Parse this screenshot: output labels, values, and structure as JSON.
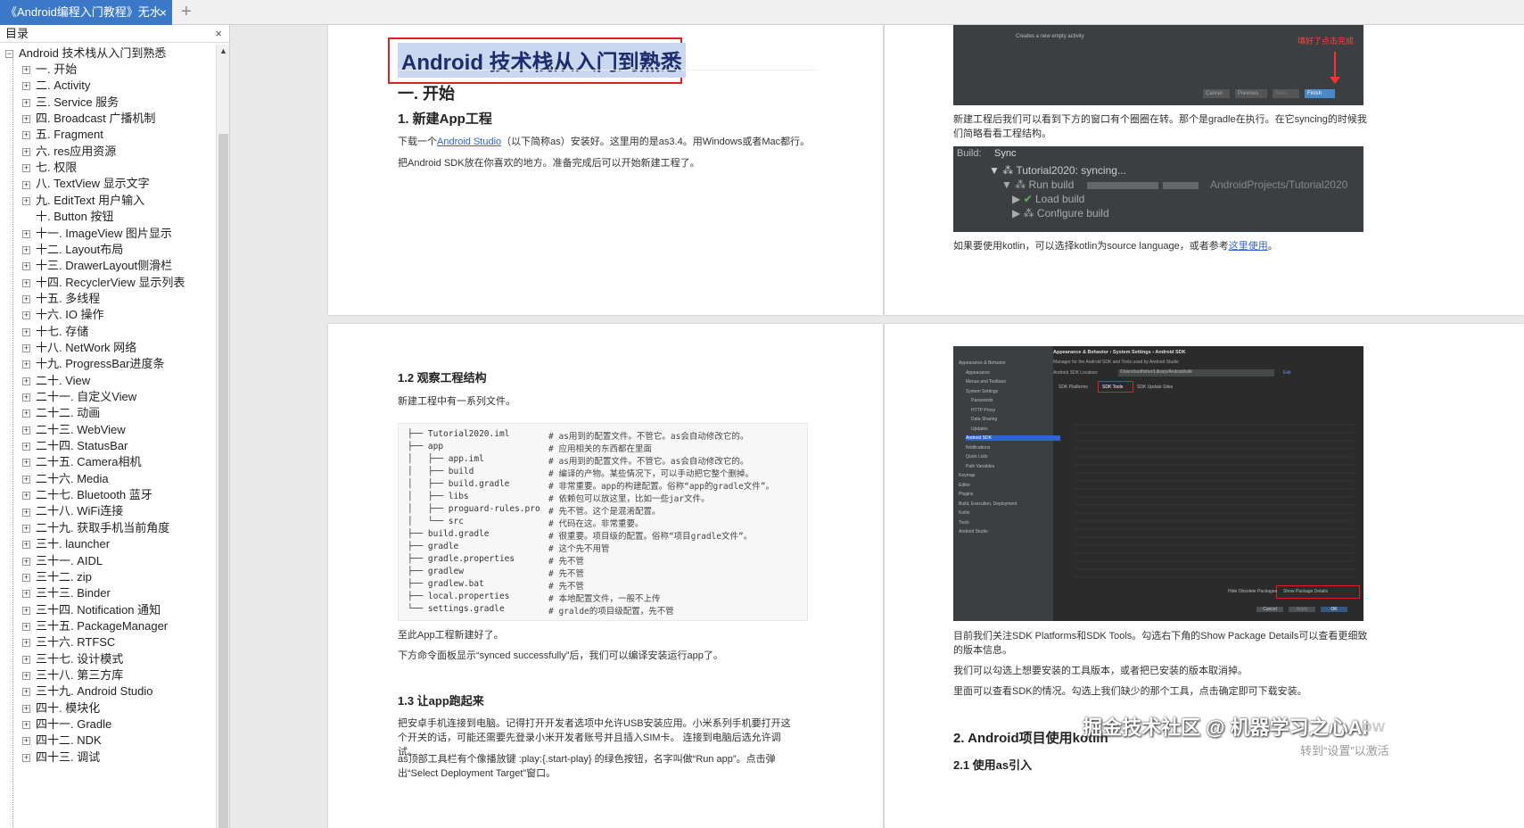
{
  "tab": {
    "title": "《Android编程入门教程》无水",
    "close": "×",
    "new": "+"
  },
  "sidebar": {
    "title": "目录",
    "close": "×",
    "root": "Android 技术栈从入门到熟悉",
    "items": [
      "一. 开始",
      "二. Activity",
      "三. Service 服务",
      "四. Broadcast 广播机制",
      "五. Fragment",
      "六. res应用资源",
      "七. 权限",
      "八. TextView 显示文字",
      "九. EditText 用户输入",
      "十. Button 按钮",
      "十一. ImageView 图片显示",
      "十二. Layout布局",
      "十三. DrawerLayout侧滑栏",
      "十四. RecyclerView 显示列表",
      "十五. 多线程",
      "十六. IO 操作",
      "十七. 存储",
      "十八. NetWork 网络",
      "十九. ProgressBar进度条",
      "二十. View",
      "二十一. 自定义View",
      "二十二. 动画",
      "二十三. WebView",
      "二十四. StatusBar",
      "二十五. Camera相机",
      "二十六. Media",
      "二十七. Bluetooth 蓝牙",
      "二十八. WiFi连接",
      "二十九. 获取手机当前角度",
      "三十. launcher",
      "三十一. AIDL",
      "三十二. zip",
      "三十三. Binder",
      "三十四. Notification 通知",
      "三十五. PackageManager",
      "三十六. RTFSC",
      "三十七. 设计模式",
      "三十八. 第三方库",
      "三十九. Android Studio",
      "四十. 模块化",
      "四十一. Gradle",
      "四十二. NDK",
      "四十三. 调试"
    ]
  },
  "page1": {
    "title": "Android 技术栈从入门到熟悉",
    "h2": "一. 开始",
    "h3": "1. 新建App工程",
    "p1_pre": "下载一个",
    "p1_link": "Android Studio",
    "p1_post": "（以下简称as）安装好。这里用的是as3.4。用Windows或者Mac都行。",
    "p2": "把Android SDK放在你喜欢的地方。准备完成后可以开始新建工程了。"
  },
  "page2": {
    "wizard_caption": "Creates a new empty activity",
    "wizard_note": "填好了点击完成",
    "wizard_buttons": [
      "Cancel",
      "Previous",
      "Next",
      "Finish"
    ],
    "p1": "新建工程后我们可以看到下方的窗口有个圈圈在转。那个是gradle在执行。在它syncing的时候我们简略看看工程结构。",
    "build_label": "Build:",
    "build_tab": "Sync",
    "build_lines": [
      "Tutorial2020: syncing...",
      "Run build",
      "Load build",
      "Configure build"
    ],
    "build_path": "AndroidProjects/Tutorial2020",
    "p2_pre": "如果要使用kotlin，可以选择kotlin为source language，或者参考",
    "p2_link": "这里使用",
    "p2_post": "。"
  },
  "page3": {
    "h3a": "1.2 观察工程结构",
    "p1": "新建工程中有一系列文件。",
    "code": [
      {
        "f": "├── Tutorial2020.iml",
        "c": "# as用到的配置文件。不管它。as会自动修改它的。"
      },
      {
        "f": "├── app",
        "c": "# 应用相关的东西都在里面"
      },
      {
        "f": "│   ├── app.iml",
        "c": "# as用到的配置文件。不管它。as会自动修改它的。"
      },
      {
        "f": "│   ├── build",
        "c": "# 编译的产物。某些情况下，可以手动把它整个删掉。"
      },
      {
        "f": "│   ├── build.gradle",
        "c": "# 非常重要。app的构建配置。俗称“app的gradle文件”。"
      },
      {
        "f": "│   ├── libs",
        "c": "# 依赖包可以放这里，比如一些jar文件。"
      },
      {
        "f": "│   ├── proguard-rules.pro",
        "c": "# 先不管。这个是混淆配置。"
      },
      {
        "f": "│   └── src",
        "c": "# 代码在这。非常重要。"
      },
      {
        "f": "├── build.gradle",
        "c": "# 很重要。项目级的配置。俗称“项目gradle文件”。"
      },
      {
        "f": "├── gradle",
        "c": "# 这个先不用管"
      },
      {
        "f": "├── gradle.properties",
        "c": "# 先不管"
      },
      {
        "f": "├── gradlew",
        "c": "# 先不管"
      },
      {
        "f": "├── gradlew.bat",
        "c": "# 先不管"
      },
      {
        "f": "├── local.properties",
        "c": "# 本地配置文件，一般不上传"
      },
      {
        "f": "└── settings.gradle",
        "c": "# gralde的项目级配置，先不管"
      }
    ],
    "p2": "至此App工程新建好了。",
    "p3": "下方命令面板显示“synced successfully”后，我们可以编译安装运行app了。",
    "h3b": "1.3 让app跑起来",
    "p4": "把安卓手机连接到电脑。记得打开开发者选项中允许USB安装应用。小米系列手机要打开这个开关的话，可能还需要先登录小米开发者账号并且插入SIM卡。 连接到电脑后选允许调试。",
    "p5": "as顶部工具栏有个像播放键 :play:{.start-play} 的绿色按钮，名字叫做“Run app”。点击弹出“Select Deployment Target”窗口。"
  },
  "page4": {
    "sdk_breadcrumb": "Appearance & Behavior  ›  System Settings  ›  Android SDK",
    "sdk_desc": "Manager for the Android SDK and Tools used by Android Studio",
    "sdk_location_label": "Android SDK Location:",
    "sdk_location": "/Users/rustfisher/Library/Android/sdk",
    "sdk_edit": "Edit",
    "sdk_tabs": [
      "SDK Platforms",
      "SDK Tools",
      "SDK Update Sites"
    ],
    "sdk_left": [
      "Appearance & Behavior",
      "Appearance",
      "Menus and Toolbars",
      "System Settings",
      "Passwords",
      "HTTP Proxy",
      "Data Sharing",
      "Updates",
      "Android SDK",
      "Notifications",
      "Quick Lists",
      "Path Variables",
      "Keymap",
      "Editor",
      "Plugins",
      "Build, Execution, Deployment",
      "Kotlin",
      "Tools",
      "Android Studio"
    ],
    "sdk_hide": "Hide Obsolete Packages",
    "sdk_show": "Show Package Details",
    "sdk_buttons": [
      "Cancel",
      "Apply",
      "OK"
    ],
    "p1": "目前我们关注SDK Platforms和SDK Tools。勾选右下角的Show Package Details可以查看更细致的版本信息。",
    "p2": "我们可以勾选上想要安装的工具版本，或者把已安装的版本取消掉。",
    "p3": "里面可以查看SDK的情况。勾选上我们缺少的那个工具，点击确定即可下载安装。",
    "h2": "2. Android项目使用kotlin",
    "h3": "2.1 使用as引入"
  },
  "watermark": {
    "main": "掘金技术社区 @ 机器学习之心AI",
    "sub": "转到“设置”以激活",
    "tail": "ow"
  }
}
